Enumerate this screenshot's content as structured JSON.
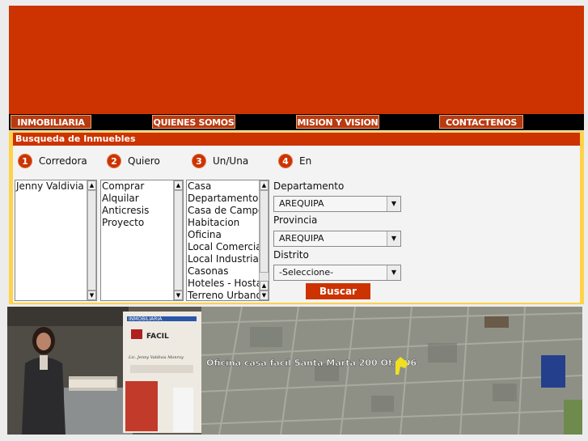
{
  "nav": [
    "INMOBILIARIA",
    "QUIENES SOMOS",
    "MISION Y VISION",
    "CONTACTENOS"
  ],
  "search": {
    "title": "Busqueda de Inmuebles",
    "steps": [
      {
        "num": "1",
        "label": "Corredora"
      },
      {
        "num": "2",
        "label": "Quiero"
      },
      {
        "num": "3",
        "label": "Un/Una"
      },
      {
        "num": "4",
        "label": "En"
      }
    ],
    "corredora_options": [
      "Jenny Valdivia"
    ],
    "quiero_options": [
      "Comprar",
      "Alquilar",
      "Anticresis",
      "Proyecto"
    ],
    "tipo_options": [
      "Casa",
      "Departamento",
      "Casa de Campo",
      "Habitacion",
      "Oficina",
      "Local Comercial",
      "Local Industrial",
      "Casonas",
      "Hoteles - Hostal",
      "Terreno Urbano"
    ],
    "departamento_label": "Departamento",
    "departamento_value": "AREQUIPA",
    "provincia_label": "Provincia",
    "provincia_value": "AREQUIPA",
    "distrito_label": "Distrito",
    "distrito_value": "-Seleccione-",
    "buscar_label": "Buscar"
  },
  "photo": {
    "sign_brand": "INMOBILIARIA",
    "sign_company": "FACIL",
    "sign_names": "Lic. Jenny Valdivia Monroy",
    "map_caption": "Oficina casa facil Santa Marta 200 Of. 106"
  },
  "colors": {
    "brand": "#cc3300",
    "accent": "#ffd24a",
    "nav": "#000000"
  }
}
